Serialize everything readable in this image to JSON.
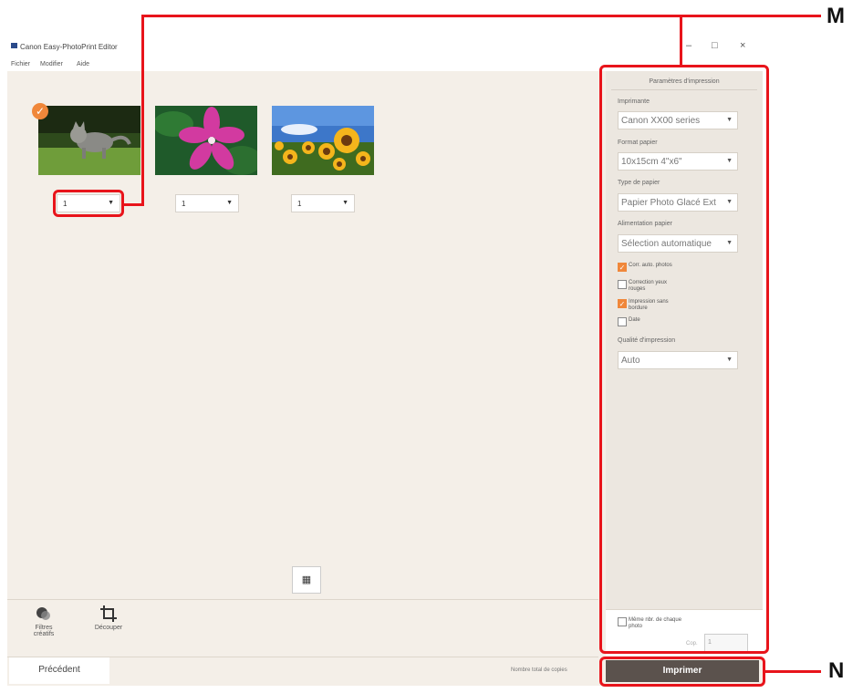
{
  "window": {
    "title": "Canon Easy-PhotoPrint Editor",
    "menu": [
      "Fichier",
      "Modifier",
      "Aide"
    ],
    "controls": {
      "minimize": "–",
      "maximize": "□",
      "close": "×"
    }
  },
  "photos": [
    {
      "kind": "cat",
      "copies": "1",
      "selected": true
    },
    {
      "kind": "flower",
      "copies": "1",
      "selected": false
    },
    {
      "kind": "sunflowers",
      "copies": "1",
      "selected": false
    }
  ],
  "panel": {
    "title": "Paramètres d'impression",
    "printer_label": "Imprimante",
    "printer_value": "Canon XX00 series",
    "paper_size_label": "Format papier",
    "paper_size_value": "10x15cm 4\"x6\"",
    "paper_type_label": "Type de papier",
    "paper_type_value": "Papier Photo Glacé Ext",
    "paper_source_label": "Alimentation papier",
    "paper_source_value": "Sélection automatique",
    "checkboxes": [
      {
        "label": "Corr. auto. photos",
        "checked": true
      },
      {
        "label": "Correction yeux rouges",
        "checked": false
      },
      {
        "label": "Impression sans bordure",
        "checked": true
      },
      {
        "label": "Date",
        "checked": false
      }
    ],
    "quality_label": "Qualité d'impression",
    "quality_value": "Auto",
    "same_count_label": "Même nbr. de chaque photo",
    "copies_label": "Cop.",
    "copies_value": "1"
  },
  "tools": [
    {
      "icon": "filters-icon",
      "label": "Filtres créatifs"
    },
    {
      "icon": "crop-icon",
      "label": "Découper"
    }
  ],
  "footer": {
    "previous_label": "Précédent",
    "total_label": "Nombre total de copies",
    "print_label": "Imprimer"
  },
  "annotations": {
    "m": "M",
    "n": "N"
  },
  "colors": {
    "accent": "#f0873a",
    "callout": "#e8141b",
    "print_button": "#5b524d",
    "background": "#f4efe8"
  }
}
